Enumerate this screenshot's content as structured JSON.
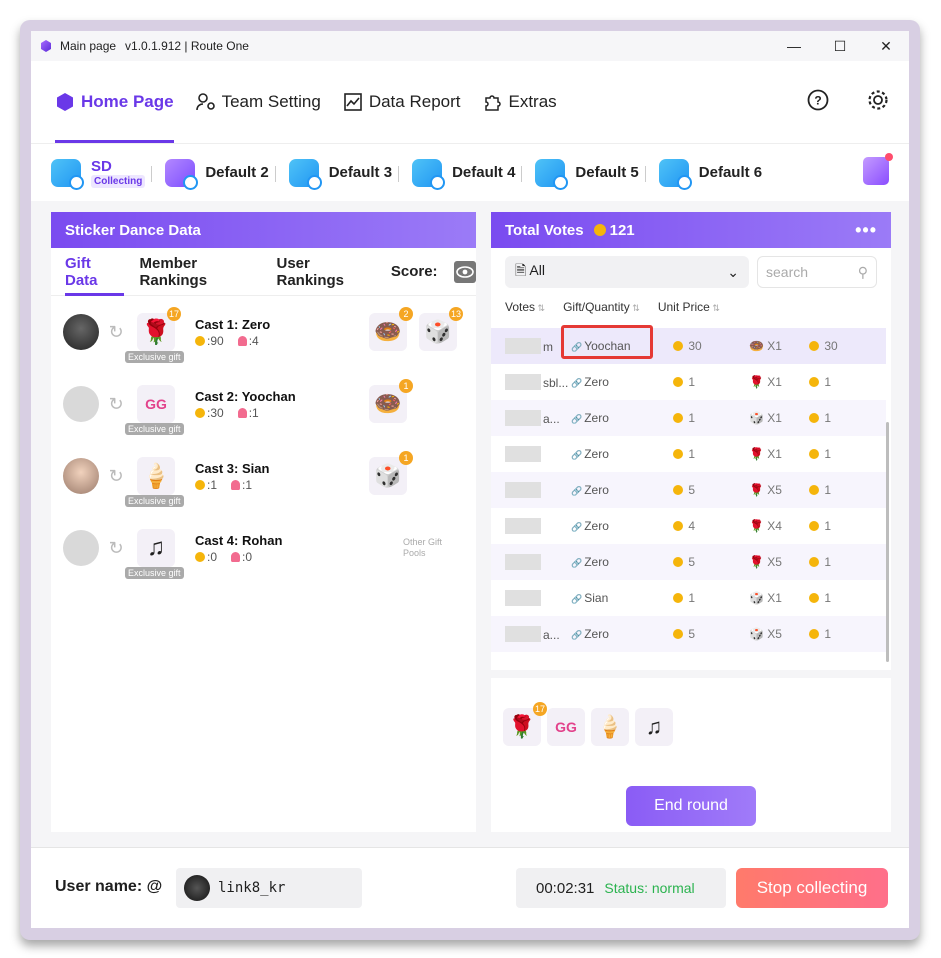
{
  "window": {
    "title": "Main page",
    "version": "v1.0.1.912 | Route One"
  },
  "nav": {
    "items": [
      {
        "label": "Home Page",
        "icon": "home-hexagon-icon"
      },
      {
        "label": "Team Setting",
        "icon": "team-gear-icon"
      },
      {
        "label": "Data Report",
        "icon": "chart-icon"
      },
      {
        "label": "Extras",
        "icon": "puzzle-icon"
      }
    ]
  },
  "presets": [
    {
      "label": "SD",
      "sub": "Collecting"
    },
    {
      "label": "Default 2"
    },
    {
      "label": "Default 3"
    },
    {
      "label": "Default 4"
    },
    {
      "label": "Default 5"
    },
    {
      "label": "Default 6"
    }
  ],
  "left_panel": {
    "title": "Sticker Dance Data",
    "tabs": [
      "Gift Data",
      "Member Rankings",
      "User Rankings",
      "Score:"
    ],
    "exclusive_label": "Exclusive gift",
    "other_pools": "Other Gift Pools",
    "casts": [
      {
        "name": "Cast 1:  Zero",
        "coins": ":90",
        "people": ":4",
        "badge": "17",
        "extras": [
          "2",
          "13"
        ]
      },
      {
        "name": "Cast 2:  Yoochan",
        "coins": ":30",
        "people": ":1",
        "badge": "",
        "extras": [
          "1"
        ]
      },
      {
        "name": "Cast 3:  Sian",
        "coins": ":1",
        "people": ":1",
        "badge": "",
        "extras": [
          "1"
        ]
      },
      {
        "name": "Cast 4:  Rohan",
        "coins": ":0",
        "people": ":0",
        "badge": "",
        "extras": []
      }
    ]
  },
  "right_panel": {
    "title": "Total Votes",
    "total": "121",
    "filter": "All",
    "search_placeholder": "search",
    "columns": [
      "Votes",
      "Gift/Quantity",
      "Unit Price"
    ],
    "rows": [
      {
        "user": "m",
        "target": "Yoochan",
        "votes": "30",
        "qty": "X1",
        "price": "30"
      },
      {
        "user": "sbl...",
        "target": "Zero",
        "votes": "1",
        "qty": "X1",
        "price": "1"
      },
      {
        "user": "a...",
        "target": "Zero",
        "votes": "1",
        "qty": "X1",
        "price": "1"
      },
      {
        "user": "",
        "target": "Zero",
        "votes": "1",
        "qty": "X1",
        "price": "1"
      },
      {
        "user": "",
        "target": "Zero",
        "votes": "5",
        "qty": "X5",
        "price": "1"
      },
      {
        "user": "",
        "target": "Zero",
        "votes": "4",
        "qty": "X4",
        "price": "1"
      },
      {
        "user": "",
        "target": "Zero",
        "votes": "5",
        "qty": "X5",
        "price": "1"
      },
      {
        "user": "",
        "target": "Sian",
        "votes": "1",
        "qty": "X1",
        "price": "1"
      },
      {
        "user": "a...",
        "target": "Zero",
        "votes": "5",
        "qty": "X5",
        "price": "1"
      }
    ],
    "tray_badge": "17",
    "end_round": "End round"
  },
  "footer": {
    "user_label": "User name: @",
    "username": "link8_kr",
    "timer": "00:02:31",
    "status": "Status: normal",
    "stop": "Stop collecting"
  },
  "colors": {
    "accent": "#6a38e8",
    "status_ok": "#2bb34f",
    "stop": "#ff7a6b"
  }
}
